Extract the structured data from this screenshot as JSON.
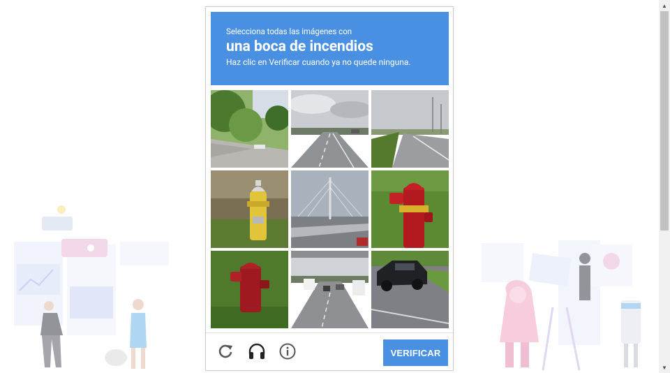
{
  "captcha": {
    "instruction_line1": "Selecciona todas las imágenes con",
    "instruction_target": "una boca de incendios",
    "instruction_line3": "Haz clic en Verificar cuando ya no quede ninguna.",
    "header_color": "#4a90e2",
    "tiles": [
      {
        "scene": "tree-lined road",
        "has_hydrant": false
      },
      {
        "scene": "highway with cloudy sky",
        "has_hydrant": false
      },
      {
        "scene": "highway with grass shoulder",
        "has_hydrant": false
      },
      {
        "scene": "yellow fire hydrant",
        "has_hydrant": true
      },
      {
        "scene": "cable-stayed bridge",
        "has_hydrant": false
      },
      {
        "scene": "red fire hydrant",
        "has_hydrant": true
      },
      {
        "scene": "red fire hydrant in grass",
        "has_hydrant": true
      },
      {
        "scene": "highway traffic",
        "has_hydrant": false
      },
      {
        "scene": "black suv on road",
        "has_hydrant": false
      }
    ],
    "footer": {
      "reload_icon": "reload-icon",
      "audio_icon": "headphones-icon",
      "info_icon": "info-icon",
      "verify_label": "VERIFICAR"
    }
  }
}
